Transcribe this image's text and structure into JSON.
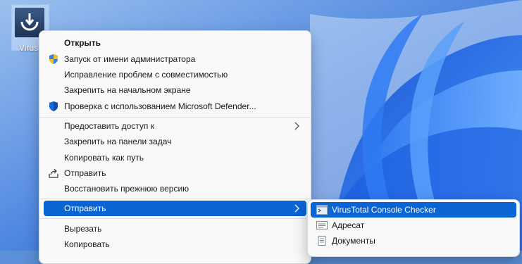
{
  "desktop": {
    "icon_label": "Virus"
  },
  "context_menu": {
    "items": [
      {
        "label": "Открыть",
        "icon": null
      },
      {
        "label": "Запуск от имени администратора",
        "icon": "uac-shield-icon"
      },
      {
        "label": "Исправление проблем с совместимостью",
        "icon": null
      },
      {
        "label": "Закрепить на начальном экране",
        "icon": null
      },
      {
        "label": "Проверка с использованием Microsoft Defender...",
        "icon": "defender-shield-icon"
      },
      {
        "label": "Предоставить доступ к",
        "icon": null,
        "submenu": true
      },
      {
        "label": "Закрепить на панели задач",
        "icon": null
      },
      {
        "label": "Копировать как путь",
        "icon": null
      },
      {
        "label": "Отправить",
        "icon": "share-icon"
      },
      {
        "label": "Восстановить прежнюю версию",
        "icon": null
      },
      {
        "label": "Отправить",
        "icon": null,
        "submenu": true,
        "highlighted": true
      },
      {
        "label": "Вырезать",
        "icon": null
      },
      {
        "label": "Копировать",
        "icon": null
      }
    ]
  },
  "send_to_submenu": {
    "items": [
      {
        "label": "VirusTotal Console Checker",
        "icon": "console-app-icon",
        "highlighted": true
      },
      {
        "label": "Адресат",
        "icon": "mail-recipient-icon"
      },
      {
        "label": "Документы",
        "icon": "documents-icon"
      }
    ]
  },
  "colors": {
    "highlight": "#0a64d2",
    "menu_bg": "#f9f9f9"
  }
}
